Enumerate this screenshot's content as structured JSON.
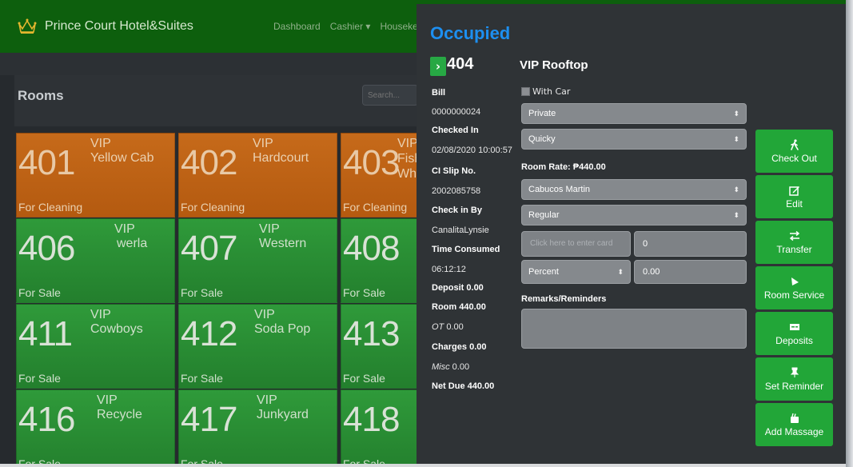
{
  "navbar": {
    "brand": "Prince Court Hotel&Suites",
    "links": [
      "Dashboard",
      "Cashier ▾",
      "Houseke"
    ]
  },
  "rooms": {
    "title": "Rooms",
    "search_placeholder": "Search...",
    "tiles": [
      {
        "number": "401",
        "vip": "VIP",
        "name": "Yellow Cab",
        "status": "For Cleaning",
        "color": "#c66a1a"
      },
      {
        "number": "402",
        "vip": "VIP",
        "name": "Hardcourt",
        "status": "For Cleaning",
        "color": "#c66a1a"
      },
      {
        "number": "403",
        "vip": "VIP",
        "name": "Fish Wh",
        "status": "For Cleaning",
        "color": "#c66a1a"
      },
      {
        "number": "406",
        "vip": "VIP",
        "name": "werla",
        "status": "For Sale",
        "color": "#2f9a3a"
      },
      {
        "number": "407",
        "vip": "VIP",
        "name": "Western",
        "status": "For Sale",
        "color": "#2f9a3a"
      },
      {
        "number": "408",
        "vip": "",
        "name": "",
        "status": "For Sale",
        "color": "#2f9a3a"
      },
      {
        "number": "411",
        "vip": "VIP",
        "name": "Cowboys",
        "status": "For Sale",
        "color": "#2f9a3a"
      },
      {
        "number": "412",
        "vip": "VIP",
        "name": "Soda Pop",
        "status": "For Sale",
        "color": "#2f9a3a"
      },
      {
        "number": "413",
        "vip": "",
        "name": "",
        "status": "For Sale",
        "color": "#2f9a3a"
      },
      {
        "number": "416",
        "vip": "VIP",
        "name": "Recycle",
        "status": "For Sale",
        "color": "#2f9a3a"
      },
      {
        "number": "417",
        "vip": "VIP",
        "name": "Junkyard",
        "status": "For Sale",
        "color": "#2f9a3a"
      },
      {
        "number": "418",
        "vip": "",
        "name": "",
        "status": "For Sale",
        "color": "#2f9a3a"
      }
    ]
  },
  "modal": {
    "status": "Occupied",
    "badge": "›",
    "room_number": "404",
    "room_type": "VIP Rooftop",
    "info": {
      "bill_label": "Bill",
      "bill_value": "0000000024",
      "checked_in_label": "Checked In",
      "checked_in_value": "02/08/2020 10:00:57",
      "ci_slip_label": "CI Slip No.",
      "ci_slip_value": "2002085758",
      "checkin_by_label": "Check in By",
      "checkin_by_value": "CanalitaLynsie",
      "time_consumed_label": "Time Consumed",
      "time_consumed_value": "06:12:12",
      "deposit": "Deposit 0.00",
      "room": "Room 440.00",
      "ot_label": "OT",
      "ot_value": "0.00",
      "charges": "Charges 0.00",
      "misc_label": "Misc",
      "misc_value": "0.00",
      "net_due": "Net Due 440.00"
    },
    "form": {
      "with_car_label": "With Car",
      "type_value": "Private",
      "mode_value": "Quicky",
      "room_rate": "Room Rate: ₱440.00",
      "guest_value": "Cabucos Martin",
      "class_value": "Regular",
      "card_placeholder": "Click here to enter card",
      "card_amount": "0",
      "discount_type": "Percent",
      "discount_value": "0.00",
      "remarks_label": "Remarks/Reminders"
    },
    "actions": [
      {
        "label": "Check Out",
        "icon": "walking-person-icon"
      },
      {
        "label": "Edit",
        "icon": "edit-icon"
      },
      {
        "label": "Transfer",
        "icon": "transfer-arrows-icon"
      },
      {
        "label": "Room Service",
        "icon": "room-service-icon"
      },
      {
        "label": "Deposits",
        "icon": "deposit-card-icon"
      },
      {
        "label": "Set Reminder",
        "icon": "pushpin-icon"
      },
      {
        "label": "Add Massage",
        "icon": "massage-icon"
      }
    ],
    "accent_color": "#22a638",
    "title_color": "#1d8ff0"
  }
}
